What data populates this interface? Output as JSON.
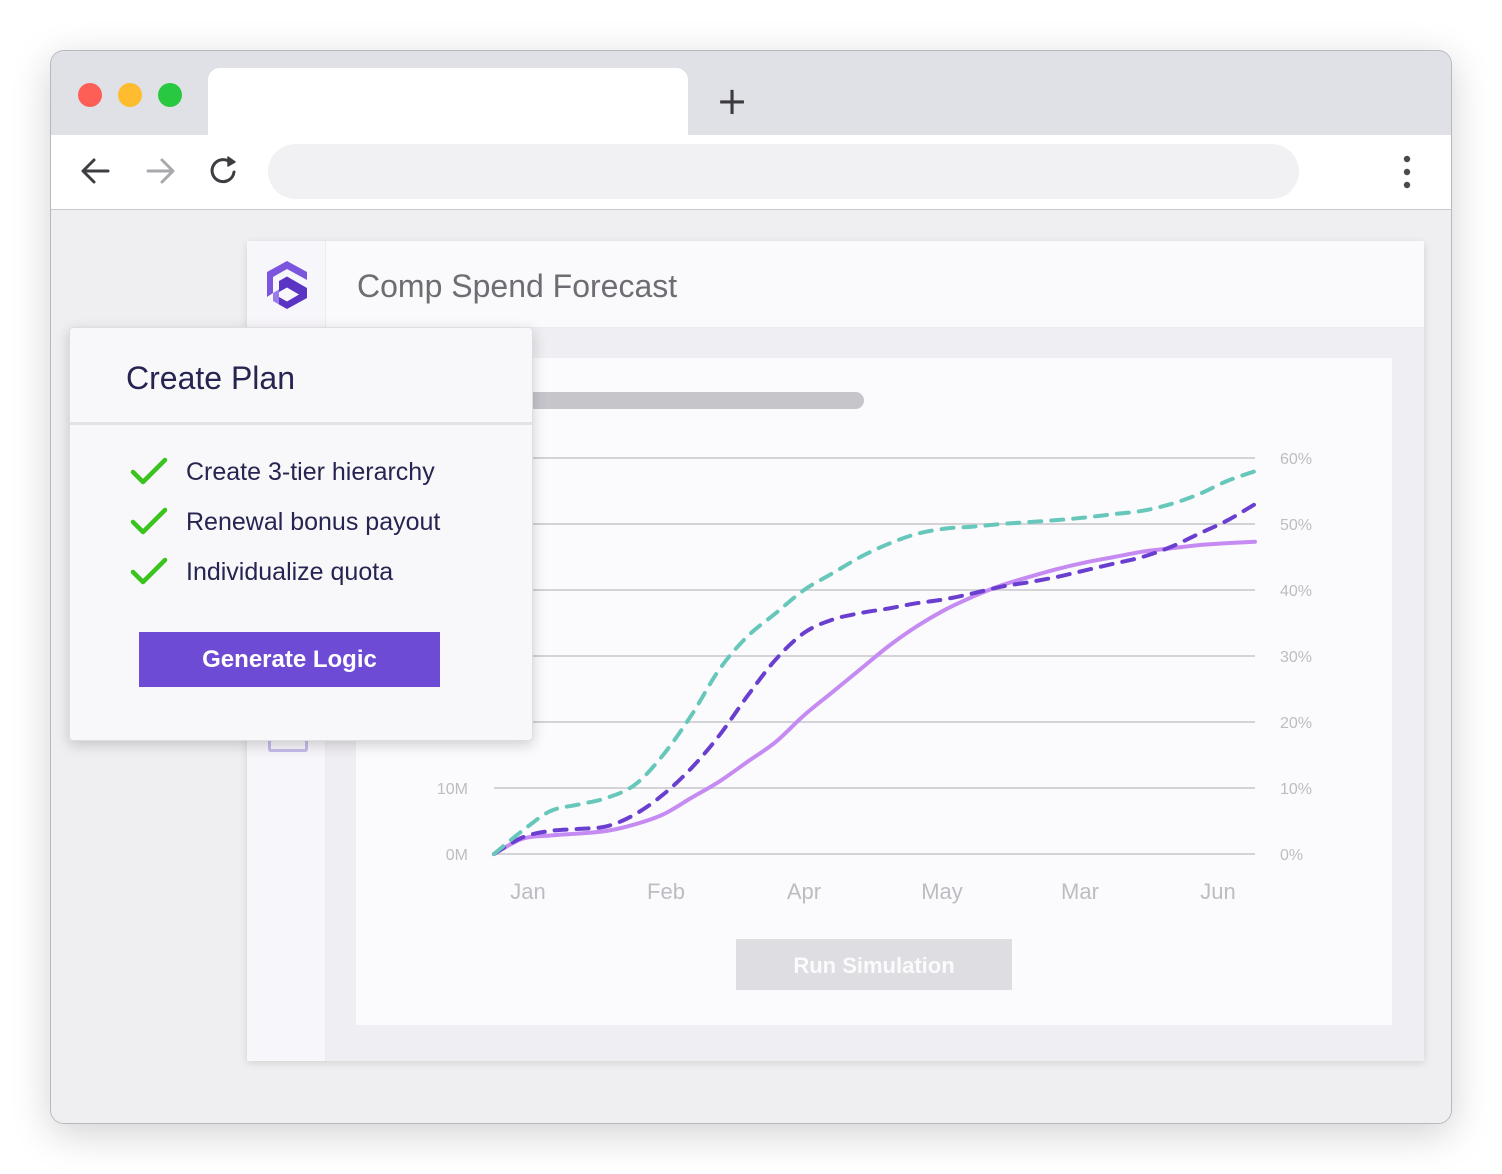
{
  "browser": {
    "controls": [
      "close",
      "minimize",
      "maximize"
    ],
    "new_tab_label": "+",
    "nav_icons": [
      "back-arrow-icon",
      "forward-arrow-icon",
      "reload-icon",
      "more-vertical-icon"
    ]
  },
  "app": {
    "title": "Comp Spend Forecast",
    "brand_color": "#6e4bd4",
    "run_button_label": "Run Simulation"
  },
  "plan_panel": {
    "title": "Create Plan",
    "tasks": [
      {
        "label": "Create 3-tier hierarchy",
        "done": true
      },
      {
        "label": "Renewal bonus payout",
        "done": true
      },
      {
        "label": "Individualize quota",
        "done": true
      }
    ],
    "button_label": "Generate Logic",
    "check_color": "#3cc41e"
  },
  "chart_data": {
    "type": "line",
    "categories": [
      "Jan",
      "Feb",
      "Apr",
      "May",
      "Mar",
      "Jun"
    ],
    "y_left_ticks": [
      "0M",
      "10M"
    ],
    "y_right_ticks": [
      "0%",
      "10%",
      "20%",
      "30%",
      "40%",
      "50%",
      "60%"
    ],
    "y_right_range": [
      0,
      60
    ],
    "grid": true,
    "x": [
      0,
      0.2,
      0.4,
      0.6,
      0.8,
      1.0,
      1.2,
      1.4,
      1.6,
      1.8,
      2.0,
      2.2,
      2.4,
      2.6,
      2.8,
      3.0,
      3.2,
      3.4,
      3.6,
      3.8,
      4.0,
      4.2,
      4.4,
      4.6,
      4.8,
      5.0,
      5.2,
      5.4
    ],
    "series": [
      {
        "color": "#67c7bb",
        "style": "dashed",
        "values": [
          0,
          3.5,
          6.5,
          7.5,
          8.5,
          10.5,
          15,
          21,
          28,
          33,
          36.5,
          40,
          42.5,
          45,
          47,
          48.5,
          49.3,
          49.6,
          50,
          50.3,
          50.6,
          51,
          51.5,
          52,
          53,
          54.5,
          56.5,
          58
        ]
      },
      {
        "color": "#6a3fcf",
        "style": "dashed",
        "values": [
          0,
          2.5,
          3.5,
          3.8,
          4.2,
          6,
          9,
          13,
          18,
          24,
          29.5,
          33.5,
          35.5,
          36.5,
          37.2,
          38,
          38.6,
          39.5,
          40.5,
          41.2,
          42,
          43,
          44,
          45,
          46.5,
          48.5,
          50.5,
          53
        ]
      },
      {
        "color": "#c58bf2",
        "style": "solid",
        "values": [
          0,
          2.3,
          2.8,
          3.1,
          3.5,
          4.5,
          6,
          8.5,
          11,
          14,
          17,
          21,
          24.5,
          28,
          31.5,
          34.5,
          37,
          39,
          40.7,
          42,
          43.2,
          44.2,
          45,
          45.8,
          46.3,
          46.8,
          47.1,
          47.3
        ]
      }
    ]
  }
}
